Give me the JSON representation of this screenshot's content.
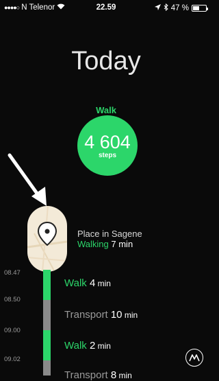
{
  "status_bar": {
    "carrier": "N Telenor",
    "time": "22.59",
    "battery": "47 %"
  },
  "header": {
    "title": "Today"
  },
  "summary": {
    "activity": "Walk",
    "steps": "4 604",
    "steps_unit": "steps"
  },
  "place": {
    "name": "Place in Sagene",
    "activity": "Walking",
    "duration": "7 min"
  },
  "timeline": {
    "times": [
      "08.47",
      "08.50",
      "09.00",
      "09.02"
    ],
    "entries": [
      {
        "activity": "Walk",
        "value": "4",
        "unit": "min"
      },
      {
        "activity": "Transport",
        "value": "10",
        "unit": "min"
      },
      {
        "activity": "Walk",
        "value": "2",
        "unit": "min"
      },
      {
        "activity": "Transport",
        "value": "8",
        "unit": "min"
      }
    ]
  },
  "colors": {
    "accent": "#2cd66a",
    "transport": "#8a8a8a"
  }
}
